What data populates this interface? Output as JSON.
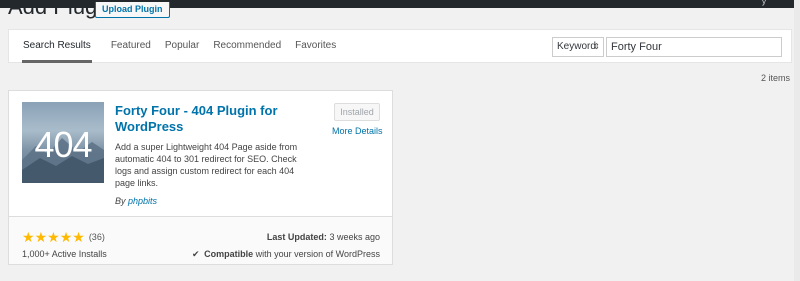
{
  "header": {
    "title": "Add Plugins",
    "upload_label": "Upload Plugin",
    "adminbar_text": "y"
  },
  "tabs": [
    {
      "label": "Search Results",
      "active": true
    },
    {
      "label": "Featured",
      "active": false
    },
    {
      "label": "Popular",
      "active": false
    },
    {
      "label": "Recommended",
      "active": false
    },
    {
      "label": "Favorites",
      "active": false
    }
  ],
  "search": {
    "type_value": "Keyword",
    "query_value": "Forty Four"
  },
  "results": {
    "count_text": "2 items"
  },
  "plugin": {
    "name": "Forty Four - 404 Plugin for WordPress",
    "thumb_text": "404",
    "status_button": "Installed",
    "more_details": "More Details",
    "description": "Add a super Lightweight 404 Page aside from automatic 404 to 301 redirect for SEO. Check logs and assign custom redirect for each 404 page links.",
    "author_prefix": "By",
    "author": "phpbits",
    "rating_stars": 5,
    "rating_count": "(36)",
    "active_installs": "1,000+ Active Installs",
    "last_updated_label": "Last Updated:",
    "last_updated_value": "3 weeks ago",
    "compatible_label": "Compatible",
    "compatible_text": "with your version of WordPress"
  },
  "colors": {
    "link": "#0073aa",
    "star": "#ffb900",
    "adminbar": "#23282d"
  }
}
